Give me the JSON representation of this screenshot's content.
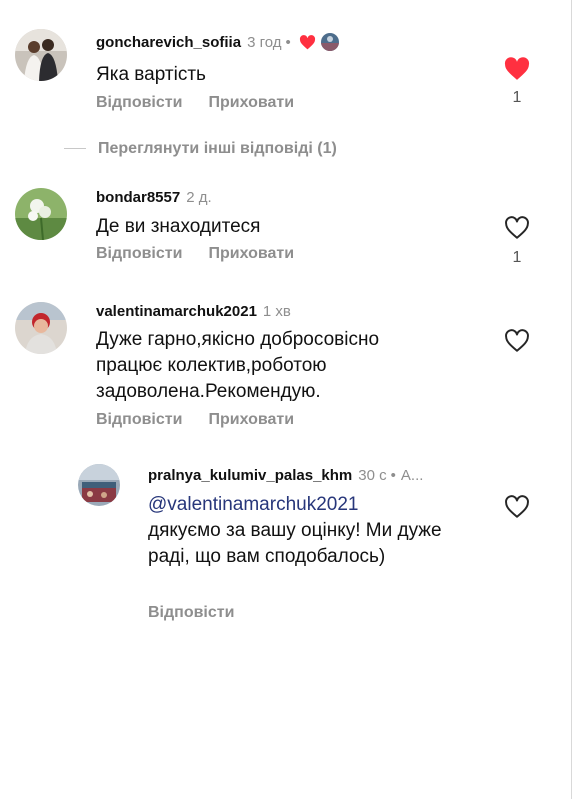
{
  "comments": [
    {
      "username": "goncharevich_sofiia",
      "time": "3 год",
      "text": "Яка вартість",
      "reply_label": "Відповісти",
      "hide_label": "Приховати",
      "like_count": "1",
      "liked": true
    },
    {
      "username": "bondar8557",
      "time": "2 д.",
      "text": "Де ви знаходитеся",
      "reply_label": "Відповісти",
      "hide_label": "Приховати",
      "like_count": "1",
      "liked": false
    },
    {
      "username": "valentinamarchuk2021",
      "time": "1 хв",
      "text": "Дуже гарно,якісно добросовісно працює колектив,роботою задоволена.Рекомендую.",
      "reply_label": "Відповісти",
      "hide_label": "Приховати",
      "liked": false
    }
  ],
  "view_replies": "Переглянути інші відповіді (1)",
  "reply": {
    "username": "pralnya_kulumiv_palas_khm",
    "time": "30 с",
    "badge": "А...",
    "mention": "@valentinamarchuk2021",
    "text": "дякуємо за вашу оцінку! Ми дуже раді, що вам сподобалось)",
    "reply_label": "Відповісти",
    "liked": false
  },
  "colors": {
    "like_red": "#ff3040",
    "muted_text": "#8e8e8e",
    "mention_blue": "#27367a"
  },
  "icons": {
    "like": "heart-icon",
    "liked": "heart-filled-icon",
    "creator_liked": "mini-heart-icon"
  }
}
